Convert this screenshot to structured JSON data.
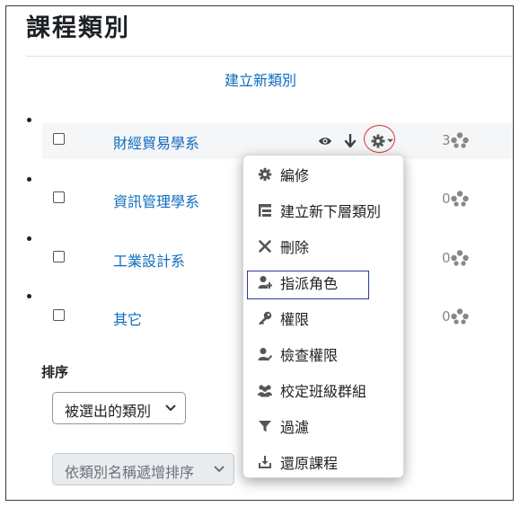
{
  "page": {
    "title": "課程類別"
  },
  "actions": {
    "create_category": "建立新類別"
  },
  "categories": [
    {
      "name": "財經貿易學系",
      "count": "3"
    },
    {
      "name": "資訊管理學系",
      "count": "0"
    },
    {
      "name": "工業設計系",
      "count": "0"
    },
    {
      "name": "其它",
      "count": "0"
    }
  ],
  "sort": {
    "label": "排序",
    "scope_select": "被選出的類別",
    "order_select": "依類別名稱遞增排序"
  },
  "menu": {
    "items": [
      {
        "label": "編修",
        "icon": "cog-icon"
      },
      {
        "label": "建立新下層類別",
        "icon": "subcategory-icon"
      },
      {
        "label": "刪除",
        "icon": "delete-x-icon"
      },
      {
        "label": "指派角色",
        "icon": "assign-role-icon"
      },
      {
        "label": "權限",
        "icon": "key-icon"
      },
      {
        "label": "檢查權限",
        "icon": "check-permission-icon"
      },
      {
        "label": "校定班級群組",
        "icon": "cohort-icon"
      },
      {
        "label": "過濾",
        "icon": "filter-icon"
      },
      {
        "label": "還原課程",
        "icon": "restore-icon"
      }
    ]
  },
  "colors": {
    "link": "#0f6cbf",
    "highlight_circle": "#d9363e",
    "focus_outline": "#2b3a9c"
  }
}
